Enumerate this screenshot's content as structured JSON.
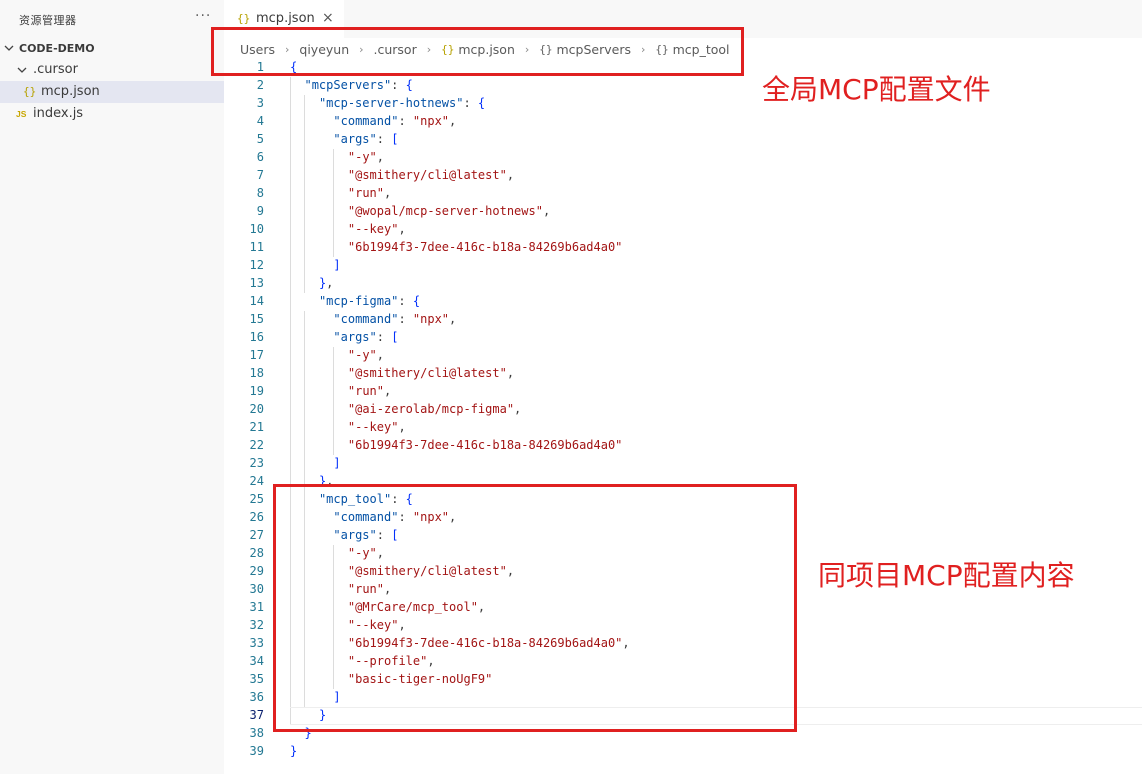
{
  "sidebar": {
    "title": "资源管理器",
    "more_label": "···",
    "project": "CODE-DEMO",
    "folder": ".cursor",
    "files": [
      {
        "name": "mcp.json",
        "icon": "json-icon"
      },
      {
        "name": "index.js",
        "icon": "js-icon"
      }
    ]
  },
  "tab": {
    "label": "mcp.json",
    "close": "×"
  },
  "breadcrumb": [
    "Users",
    "qiyeyun",
    ".cursor",
    "mcp.json",
    "mcpServers",
    "mcp_tool"
  ],
  "editor": {
    "current_line": 37,
    "lines": [
      "{",
      "  \"mcpServers\": {",
      "    \"mcp-server-hotnews\": {",
      "      \"command\": \"npx\",",
      "      \"args\": [",
      "        \"-y\",",
      "        \"@smithery/cli@latest\",",
      "        \"run\",",
      "        \"@wopal/mcp-server-hotnews\",",
      "        \"--key\",",
      "        \"6b1994f3-7dee-416c-b18a-84269b6ad4a0\"",
      "      ]",
      "    },",
      "    \"mcp-figma\": {",
      "      \"command\": \"npx\",",
      "      \"args\": [",
      "        \"-y\",",
      "        \"@smithery/cli@latest\",",
      "        \"run\",",
      "        \"@ai-zerolab/mcp-figma\",",
      "        \"--key\",",
      "        \"6b1994f3-7dee-416c-b18a-84269b6ad4a0\"",
      "      ]",
      "    },",
      "    \"mcp_tool\": {",
      "      \"command\": \"npx\",",
      "      \"args\": [",
      "        \"-y\",",
      "        \"@smithery/cli@latest\",",
      "        \"run\",",
      "        \"@MrCare/mcp_tool\",",
      "        \"--key\",",
      "        \"6b1994f3-7dee-416c-b18a-84269b6ad4a0\",",
      "        \"--profile\",",
      "        \"basic-tiger-noUgF9\"",
      "      ]",
      "    }",
      "  }",
      "}"
    ]
  },
  "annotations": {
    "global_note": "全局MCP配置文件",
    "project_note": "同项目MCP配置内容",
    "color": "#e02020"
  },
  "colors": {
    "key": "#0451a5",
    "string": "#a31515",
    "bracket": "#0431fa",
    "line_number": "#237893",
    "selected_row": "#e4e6f1"
  }
}
